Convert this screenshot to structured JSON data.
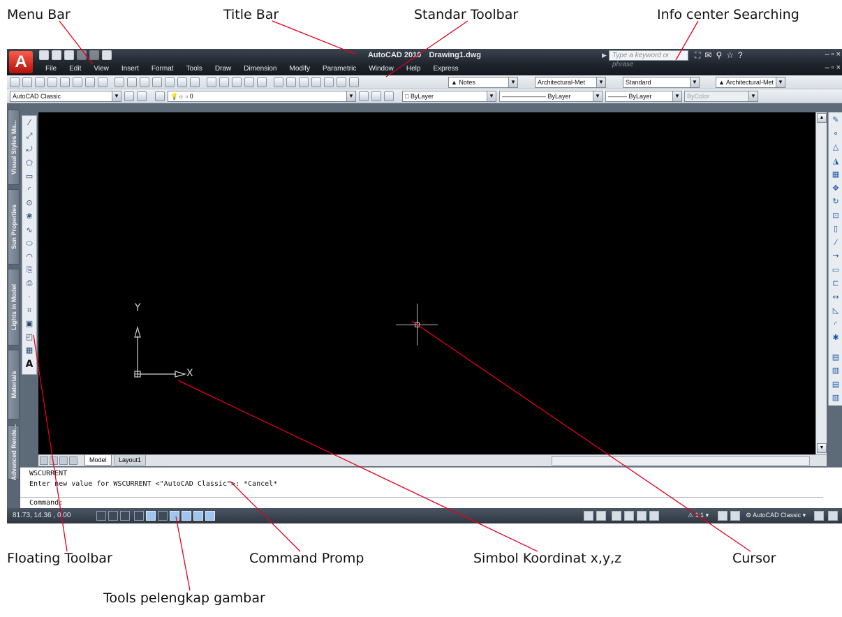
{
  "annotations": {
    "menu_bar": "Menu Bar",
    "title_bar": "Title Bar",
    "standard_toolbar": "Standar Toolbar",
    "info_center": "Info center Searching",
    "floating_toolbar": "Floating Toolbar",
    "command_prompt": "Command Promp",
    "coordinate_symbol": "Simbol Koordinat x,y,z",
    "cursor": "Cursor",
    "drawing_aids": "Tools pelengkap gambar",
    "line_color": "#e3001b"
  },
  "window": {
    "app_name": "AutoCAD 2010",
    "document": "Drawing1.dwg",
    "logo_letter": "A",
    "search_placeholder": "Type a keyword or phrase",
    "min_max_close": "– ▫ ×"
  },
  "menus": [
    "File",
    "Edit",
    "View",
    "Insert",
    "Format",
    "Tools",
    "Draw",
    "Dimension",
    "Modify",
    "Parametric",
    "Window",
    "Help",
    "Express"
  ],
  "toolbars": {
    "text_style": "Notes",
    "dim_style": "Architectural-Met",
    "table_style": "Standard",
    "mleader_style": "Architectural-Met",
    "workspace": "AutoCAD Classic",
    "layer": "0",
    "color": "ByLayer",
    "linetype": "ByLayer",
    "lineweight": "ByLayer",
    "plot_style": "ByColor"
  },
  "palettes": [
    "Visual Styles Ma...",
    "Sun Properties",
    "Lights in Model",
    "Materials",
    "Advanced Rende..."
  ],
  "draw_tools": [
    "line-icon",
    "xline-icon",
    "polyline-icon",
    "polygon-icon",
    "rectangle-icon",
    "arc-icon",
    "circle-icon",
    "revcloud-icon",
    "spline-icon",
    "ellipse-icon",
    "ellipse-arc-icon",
    "insert-block-icon",
    "make-block-icon",
    "point-icon",
    "hatch-icon",
    "gradient-icon",
    "region-icon",
    "table-icon",
    "mtext-icon"
  ],
  "draw_glyphs": [
    "⁄",
    "⤢",
    "⤾",
    "⬠",
    "▭",
    "◜",
    "⊙",
    "❀",
    "∿",
    "⬭",
    "◠",
    "⎘",
    "⎙",
    "·",
    "⌗",
    "▣",
    "◰",
    "▦",
    "A"
  ],
  "modify_glyphs": [
    "✎",
    "⚬",
    "△",
    "◮",
    "▦",
    "✥",
    "↻",
    "⊡",
    "▯",
    "⁄",
    "→",
    "▭",
    "⊏",
    "↔",
    "◺",
    "◜",
    "✱",
    "▤",
    "▥",
    "▤",
    "▥"
  ],
  "ucs": {
    "x_label": "X",
    "y_label": "Y"
  },
  "layout_tabs": {
    "model": "Model",
    "layout1": "Layout1"
  },
  "command": {
    "line1": "WSCURRENT",
    "line2": "Enter new value for WSCURRENT <\"AutoCAD Classic\">: *Cancel*",
    "prompt": "Command:"
  },
  "status": {
    "coordinates": "81.73, 14.36 , 0.00",
    "annotation_scale": "1:1",
    "workspace": "AutoCAD Classic"
  },
  "colors": {
    "canvas": "#000000",
    "title_bar": "#20262e",
    "toggle_on": "#9fc4ee"
  }
}
